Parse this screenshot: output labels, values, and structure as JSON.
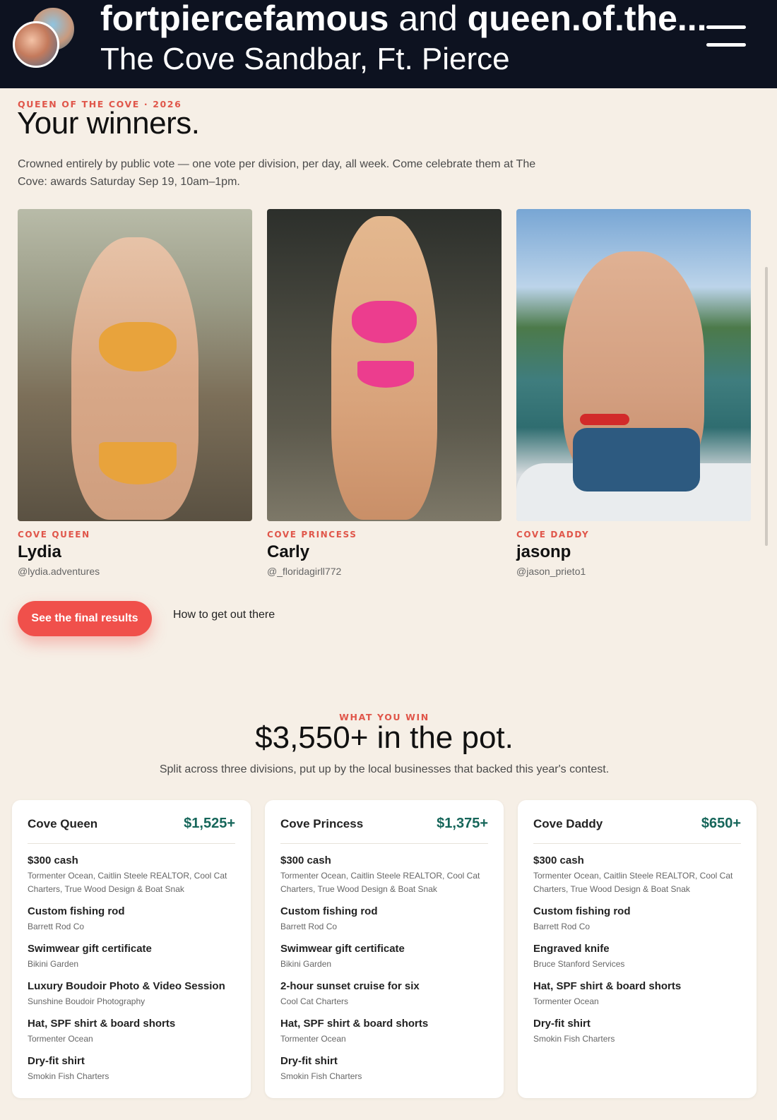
{
  "story": {
    "account_1": "fortpiercefamous",
    "and": "and",
    "account_2": "queen.of.the...",
    "location": "The Cove Sandbar, Ft. Pierce",
    "menu_icon": "hamburger-menu-icon"
  },
  "hero": {
    "eyebrow": "QUEEN OF THE COVE · 2026",
    "title": "Your winners.",
    "description": "Crowned entirely by public vote — one vote per division, per day, all week. Come celebrate them at The Cove: awards Saturday Sep 19, 10am–1pm."
  },
  "winners": [
    {
      "division": "COVE QUEEN",
      "name": "Lydia",
      "handle": "@lydia.adventures"
    },
    {
      "division": "COVE PRINCESS",
      "name": "Carly",
      "handle": "@_floridagirll772"
    },
    {
      "division": "COVE DADDY",
      "name": "jasonp",
      "handle": "@jason_prieto1"
    }
  ],
  "actions": {
    "primary": "See the final results",
    "secondary": "How to get out there"
  },
  "pot": {
    "eyebrow": "WHAT YOU WIN",
    "title": "$3,550+ in the pot.",
    "description": "Split across three divisions, put up by the local businesses that backed this year's contest."
  },
  "prizes": [
    {
      "name": "Cove Queen",
      "amount": "$1,525+",
      "items": [
        {
          "title": "$300 cash",
          "sponsor": "Tormenter Ocean, Caitlin Steele REALTOR, Cool Cat Charters, True Wood Design & Boat Snak"
        },
        {
          "title": "Custom fishing rod",
          "sponsor": "Barrett Rod Co"
        },
        {
          "title": "Swimwear gift certificate",
          "sponsor": "Bikini Garden"
        },
        {
          "title": "Luxury Boudoir Photo & Video Session",
          "sponsor": "Sunshine Boudoir Photography"
        },
        {
          "title": "Hat, SPF shirt & board shorts",
          "sponsor": "Tormenter Ocean"
        },
        {
          "title": "Dry-fit shirt",
          "sponsor": "Smokin Fish Charters"
        }
      ]
    },
    {
      "name": "Cove Princess",
      "amount": "$1,375+",
      "items": [
        {
          "title": "$300 cash",
          "sponsor": "Tormenter Ocean, Caitlin Steele REALTOR, Cool Cat Charters, True Wood Design & Boat Snak"
        },
        {
          "title": "Custom fishing rod",
          "sponsor": "Barrett Rod Co"
        },
        {
          "title": "Swimwear gift certificate",
          "sponsor": "Bikini Garden"
        },
        {
          "title": "2-hour sunset cruise for six",
          "sponsor": "Cool Cat Charters"
        },
        {
          "title": "Hat, SPF shirt & board shorts",
          "sponsor": "Tormenter Ocean"
        },
        {
          "title": "Dry-fit shirt",
          "sponsor": "Smokin Fish Charters"
        }
      ]
    },
    {
      "name": "Cove Daddy",
      "amount": "$650+",
      "items": [
        {
          "title": "$300 cash",
          "sponsor": "Tormenter Ocean, Caitlin Steele REALTOR, Cool Cat Charters, True Wood Design & Boat Snak"
        },
        {
          "title": "Custom fishing rod",
          "sponsor": "Barrett Rod Co"
        },
        {
          "title": "Engraved knife",
          "sponsor": "Bruce Stanford Services"
        },
        {
          "title": "Hat, SPF shirt & board shorts",
          "sponsor": "Tormenter Ocean"
        },
        {
          "title": "Dry-fit shirt",
          "sponsor": "Smokin Fish Charters"
        }
      ]
    }
  ],
  "colors": {
    "accent": "#f0504b",
    "eyebrow": "#e0564a",
    "amount": "#16665a",
    "background": "#f6efe6",
    "header": "#0d1220"
  }
}
